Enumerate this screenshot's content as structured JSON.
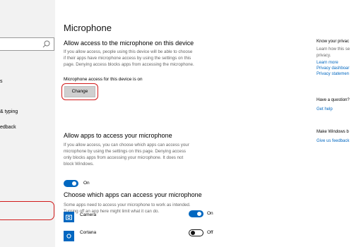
{
  "sidebar": {
    "search": {
      "placeholder": ""
    },
    "items": [
      {
        "label": "s"
      },
      {
        "label": "& typing"
      },
      {
        "label": "edback"
      }
    ]
  },
  "main": {
    "title": "Microphone",
    "section1": {
      "heading": "Allow access to the microphone on this device",
      "description_lines": [
        "If you allow access, people using this device will be able to choose",
        "if their apps have microphone access by using the settings on this",
        "page. Denying access blocks apps from accessing the microphone."
      ],
      "status": "Microphone access for this device is on",
      "button_label": "Change"
    },
    "section2": {
      "heading": "Allow apps to access your microphone",
      "description_lines": [
        "If you allow access, you can choose which apps can access your",
        "microphone by using the settings on this page. Denying access",
        "only blocks apps from accessing your microphone. It does not",
        "block Windows."
      ],
      "toggle_label": "On",
      "toggle_state": "on"
    },
    "section3": {
      "heading": "Choose which apps can access your microphone",
      "description_lines": [
        "Some apps need to access your microphone to work as intended.",
        "Turning off an app here might limit what it can do."
      ],
      "apps": [
        {
          "name": "Camera",
          "icon": "camera-icon",
          "toggle_label": "On",
          "state": "on"
        },
        {
          "name": "Cortana",
          "icon": "cortana-icon",
          "toggle_label": "Off",
          "state": "off"
        }
      ]
    }
  },
  "right_panel": {
    "privacy_heading": "Know your privac",
    "privacy_text_lines": [
      "Learn how this se",
      "privacy."
    ],
    "links": [
      "Learn more",
      "Privacy dashboar",
      "Privacy statemen"
    ],
    "question_heading": "Have a question?",
    "help_link": "Get help",
    "windows_heading": "Make Windows b",
    "feedback_link": "Give us feedback"
  },
  "colors": {
    "accent": "#0067c0",
    "highlight": "#d11a1a",
    "sidebar_bg": "#f2f2f2"
  }
}
